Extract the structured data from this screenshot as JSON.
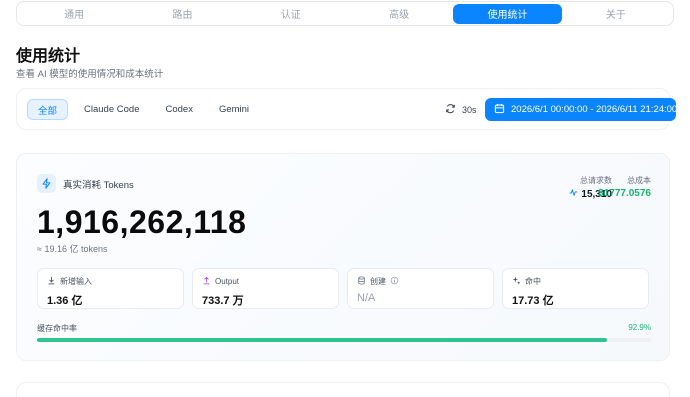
{
  "nav": {
    "tabs": [
      {
        "label": "通用"
      },
      {
        "label": "路由"
      },
      {
        "label": "认证"
      },
      {
        "label": "高级"
      },
      {
        "label": "使用统计"
      },
      {
        "label": "关于"
      }
    ],
    "active_index": 4
  },
  "header": {
    "title": "使用统计",
    "subtitle": "查看 AI 模型的使用情况和成本统计"
  },
  "filters": {
    "chips": [
      {
        "label": "全部"
      },
      {
        "label": "Claude Code"
      },
      {
        "label": "Codex"
      },
      {
        "label": "Gemini"
      }
    ],
    "active_chip": 0,
    "refresh_interval": "30s",
    "date_range": "2026/6/1 00:00:00 - 2026/6/11 21:24:00"
  },
  "summary": {
    "label": "真实消耗 Tokens",
    "total_requests_label": "总请求数",
    "total_requests": "15,310",
    "total_cost_label": "总成本",
    "total_cost": "$1777.0576",
    "big_value": "1,916,262,118",
    "big_sub": "≈ 19.16 亿 tokens",
    "metrics": [
      {
        "label": "新增输入",
        "value": "1.36 亿",
        "icon": "download-icon"
      },
      {
        "label": "Output",
        "value": "733.7 万",
        "icon": "upload-icon"
      },
      {
        "label": "创建",
        "value": "N/A",
        "icon": "database-icon"
      },
      {
        "label": "命中",
        "value": "17.73 亿",
        "icon": "sparkle-icon"
      }
    ],
    "cache_hit_label": "缓存命中率",
    "cache_hit_value": "92.9%",
    "cache_hit_fraction": 0.929
  },
  "colors": {
    "accent": "#0a84ff",
    "success": "#16b36e",
    "bar": "#2fc48d"
  }
}
